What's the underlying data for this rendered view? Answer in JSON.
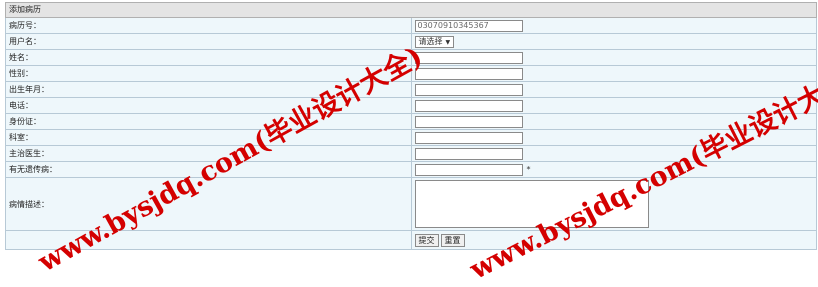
{
  "form": {
    "title": "添加病历",
    "fields": {
      "record_no": {
        "label": "病历号：",
        "value": "03070910345367"
      },
      "username": {
        "label": "用户名：",
        "selected": "请选择"
      },
      "name": {
        "label": "姓名："
      },
      "gender": {
        "label": "性别："
      },
      "birth": {
        "label": "出生年月："
      },
      "phone": {
        "label": "电话："
      },
      "id_card": {
        "label": "身份证："
      },
      "department": {
        "label": "科室："
      },
      "doctor": {
        "label": "主治医生："
      },
      "hereditary": {
        "label": "有无遗传病：",
        "required_mark": "*"
      },
      "description": {
        "label": "病情描述："
      }
    },
    "buttons": {
      "submit": "提交",
      "reset": "重置"
    }
  },
  "watermark": {
    "text_left": "www.bysjdq.com(毕业设计大全)",
    "text_right": "www.bysjdq.com(毕业设计大",
    "color": "#d40000"
  }
}
